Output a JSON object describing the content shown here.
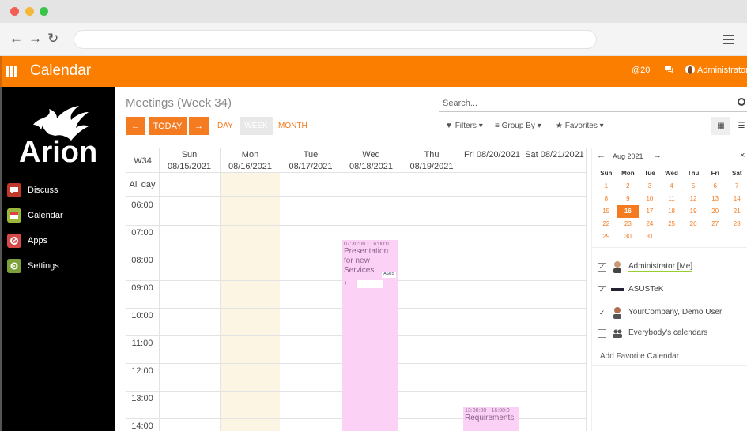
{
  "app": {
    "title": "Calendar",
    "notifications_count": "20",
    "user_name": "Administrator"
  },
  "sidebar": {
    "logo_text": "Arion",
    "items": [
      {
        "label": "Discuss",
        "icon": "chat-bubble-icon",
        "color": "#c0392b"
      },
      {
        "label": "Calendar",
        "icon": "calendar-icon",
        "color": "#9bb83a"
      },
      {
        "label": "Apps",
        "icon": "apps-icon",
        "color": "#d44a4a"
      },
      {
        "label": "Settings",
        "icon": "gear-icon",
        "color": "#7ca13a"
      }
    ]
  },
  "toolbar": {
    "page_title": "Meetings (Week 34)",
    "search_placeholder": "Search...",
    "prev_label": "←",
    "today_label": "TODAY",
    "next_label": "→",
    "day_label": "DAY",
    "week_label": "WEEK",
    "month_label": "MONTH",
    "filters_label": "Filters",
    "groupby_label": "Group By",
    "favorites_label": "Favorites"
  },
  "week": {
    "week_label": "W34",
    "allday_label": "All day",
    "days": [
      {
        "name": "Sun",
        "date": "08/15/2021"
      },
      {
        "name": "Mon",
        "date": "08/16/2021"
      },
      {
        "name": "Tue",
        "date": "08/17/2021"
      },
      {
        "name": "Wed",
        "date": "08/18/2021"
      },
      {
        "name": "Thu",
        "date": "08/19/2021"
      },
      {
        "name": "Fri",
        "date": "08/20/2021"
      },
      {
        "name": "Sat",
        "date": "08/21/2021"
      }
    ],
    "times": [
      "06:00",
      "07:00",
      "08:00",
      "09:00",
      "10:00",
      "11:00",
      "12:00",
      "13:00",
      "14:00"
    ],
    "events": [
      {
        "time": "07:30:00 - 16:00:0",
        "title": "Presentation for new Services",
        "day": "Wed"
      },
      {
        "time": "13:30:00 - 16:00:0",
        "title": "Requirements",
        "day": "Fri"
      }
    ]
  },
  "mini_calendar": {
    "month_label": "Aug 2021",
    "weekdays": [
      "Sun",
      "Mon",
      "Tue",
      "Wed",
      "Thu",
      "Fri",
      "Sat"
    ],
    "weeks": [
      [
        "1",
        "2",
        "3",
        "4",
        "5",
        "6",
        "7"
      ],
      [
        "8",
        "9",
        "10",
        "11",
        "12",
        "13",
        "14"
      ],
      [
        "15",
        "16",
        "17",
        "18",
        "19",
        "20",
        "21"
      ],
      [
        "22",
        "23",
        "24",
        "25",
        "26",
        "27",
        "28"
      ],
      [
        "29",
        "30",
        "31",
        "",
        "",
        "",
        ""
      ]
    ],
    "selected_day": "16"
  },
  "calendars": [
    {
      "name": "Administrator [Me]",
      "checked": true,
      "underline": "#9acd32"
    },
    {
      "name": "ASUSTeK",
      "checked": true,
      "underline": "#87ceeb"
    },
    {
      "name": "YourCompany, Demo User",
      "checked": true,
      "underline": "#ffb6c1"
    },
    {
      "name": "Everybody's calendars",
      "checked": false,
      "underline": "#ffffff"
    }
  ],
  "add_favorite_label": "Add Favorite Calendar",
  "colors": {
    "brand": "#fb7e00",
    "accent": "#f47b20",
    "event_bg": "#fbd2f5",
    "today_bg": "#fcf5e3"
  }
}
